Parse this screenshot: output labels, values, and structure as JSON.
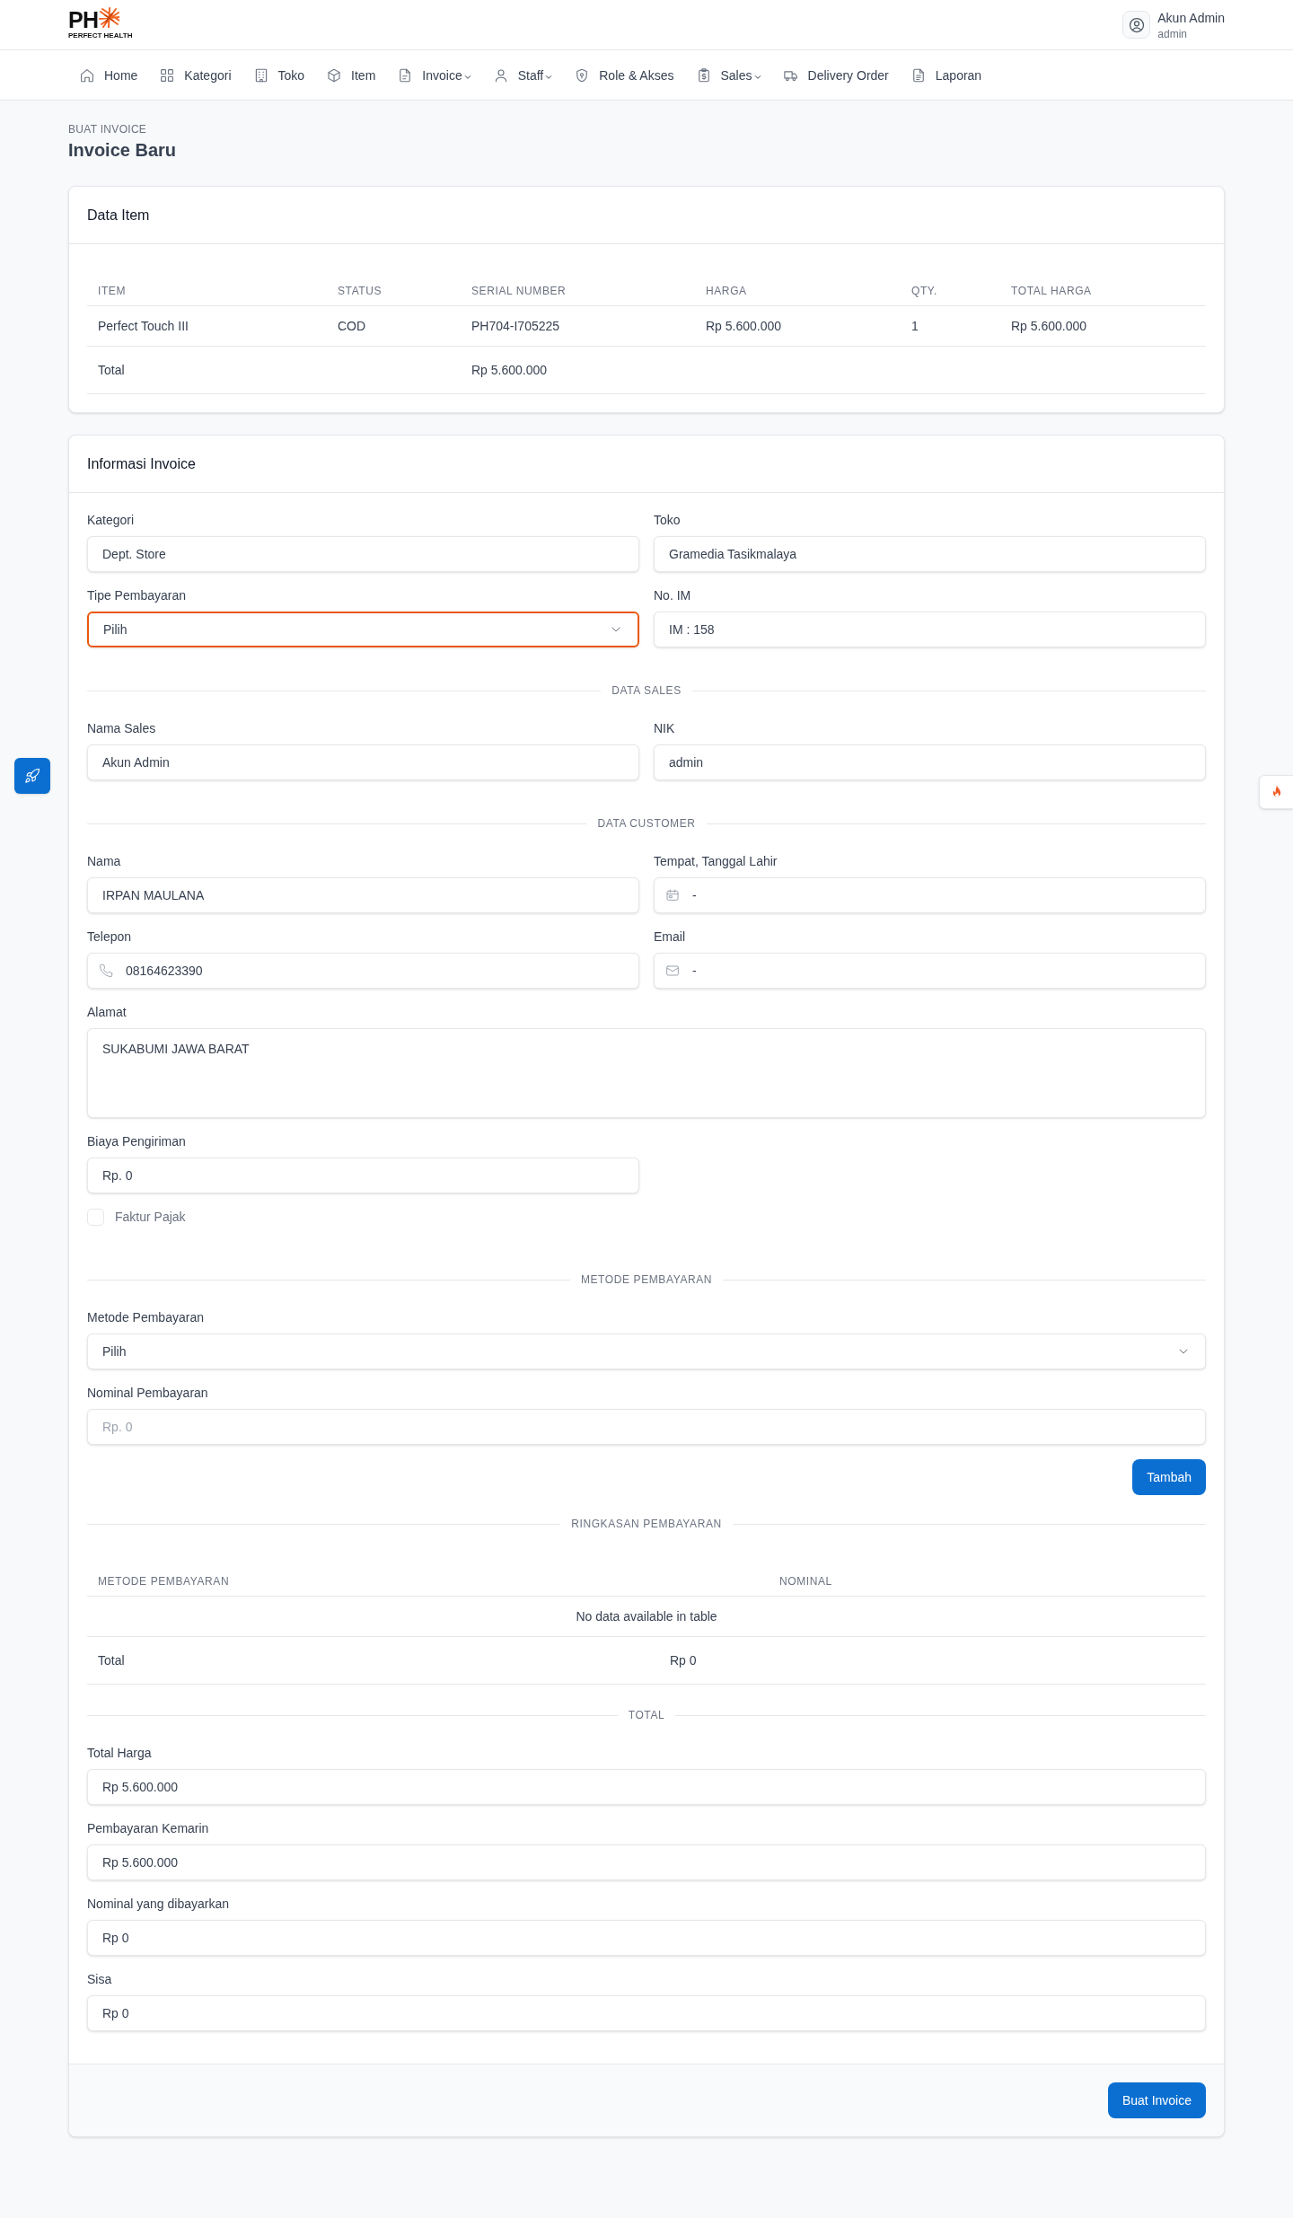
{
  "header": {
    "logo": {
      "mark": "PH",
      "tagline": "PERFECT HEALTH"
    },
    "user": {
      "name": "Akun Admin",
      "role": "admin"
    }
  },
  "nav": [
    {
      "label": "Home",
      "dropdown": false
    },
    {
      "label": "Kategori",
      "dropdown": false
    },
    {
      "label": "Toko",
      "dropdown": false
    },
    {
      "label": "Item",
      "dropdown": false
    },
    {
      "label": "Invoice",
      "dropdown": true
    },
    {
      "label": "Staff",
      "dropdown": true
    },
    {
      "label": "Role & Akses",
      "dropdown": false
    },
    {
      "label": "Sales",
      "dropdown": true
    },
    {
      "label": "Delivery Order",
      "dropdown": false
    },
    {
      "label": "Laporan",
      "dropdown": false
    }
  ],
  "page": {
    "breadcrumb": "BUAT INVOICE",
    "title": "Invoice Baru"
  },
  "data_item": {
    "title": "Data Item",
    "columns": [
      "ITEM",
      "STATUS",
      "SERIAL NUMBER",
      "HARGA",
      "QTY.",
      "TOTAL HARGA"
    ],
    "rows": [
      [
        "Perfect Touch III",
        "COD",
        "PH704-I705225",
        "Rp 5.600.000",
        "1",
        "Rp 5.600.000"
      ]
    ],
    "total": {
      "label": "Total",
      "value": "Rp 5.600.000"
    }
  },
  "invoice_info": {
    "title": "Informasi Invoice",
    "sections": [
      {
        "kind": "field_grid",
        "fields": [
          {
            "kind": "text",
            "label": "Kategori",
            "value": "Dept. Store",
            "focused": false
          },
          {
            "kind": "text",
            "label": "Toko",
            "value": "Gramedia Tasikmalaya",
            "focused": false
          },
          {
            "kind": "select",
            "label": "Tipe Pembayaran",
            "value": "Pilih",
            "focused": true
          },
          {
            "kind": "text",
            "label": "No. IM",
            "value": "IM : 158",
            "focused": false
          }
        ]
      },
      {
        "kind": "divider",
        "label": "DATA SALES"
      },
      {
        "kind": "field_grid",
        "fields": [
          {
            "kind": "text",
            "label": "Nama Sales",
            "value": "Akun Admin",
            "focused": false
          },
          {
            "kind": "text",
            "label": "NIK",
            "value": "admin",
            "focused": false
          }
        ]
      },
      {
        "kind": "divider",
        "label": "DATA CUSTOMER"
      },
      {
        "kind": "field_grid",
        "fields": [
          {
            "kind": "text",
            "label": "Nama",
            "value": "IRPAN MAULANA",
            "focused": false
          },
          {
            "kind": "date",
            "label": "Tempat, Tanggal Lahir",
            "value": "-",
            "focused": false
          },
          {
            "kind": "phone",
            "label": "Telepon",
            "value": "08164623390",
            "focused": false
          },
          {
            "kind": "email",
            "label": "Email",
            "value": "-",
            "focused": false
          }
        ]
      },
      {
        "kind": "field_stack",
        "fields": [
          {
            "kind": "textarea",
            "label": "Alamat",
            "value": "SUKABUMI JAWA BARAT",
            "focused": false
          }
        ]
      },
      {
        "kind": "field_grid",
        "fields": [
          {
            "kind": "text",
            "label": "Biaya Pengiriman",
            "value": "Rp. 0",
            "focused": false
          }
        ]
      },
      {
        "kind": "checkbox",
        "label": "Faktur Pajak",
        "checked": false
      },
      {
        "kind": "divider",
        "label": "METODE PEMBAYARAN"
      },
      {
        "kind": "field_stack",
        "fields": [
          {
            "kind": "select",
            "label": "Metode Pembayaran",
            "value": "Pilih",
            "focused": false
          },
          {
            "kind": "text",
            "label": "Nominal Pembayaran",
            "placeholder": "Rp. 0",
            "focused": false
          }
        ]
      },
      {
        "kind": "button",
        "label": "Tambah"
      },
      {
        "kind": "divider",
        "label": "RINGKASAN PEMBAYARAN"
      },
      {
        "kind": "table",
        "columns": [
          "METODE PEMBAYARAN",
          "NOMINAL"
        ],
        "empty_message": "No data available in table",
        "total": {
          "label": "Total",
          "value": "Rp 0"
        }
      },
      {
        "kind": "divider",
        "label": "TOTAL"
      },
      {
        "kind": "field_stack",
        "fields": [
          {
            "kind": "text",
            "label": "Total Harga",
            "value": "Rp 5.600.000",
            "focused": false
          },
          {
            "kind": "text",
            "label": "Pembayaran Kemarin",
            "value": "Rp 5.600.000",
            "focused": false
          },
          {
            "kind": "text",
            "label": "Nominal yang dibayarkan",
            "value": "Rp 0",
            "focused": false
          },
          {
            "kind": "text",
            "label": "Sisa",
            "value": "Rp 0",
            "focused": false
          }
        ]
      }
    ],
    "submit": "Buat Invoice"
  }
}
